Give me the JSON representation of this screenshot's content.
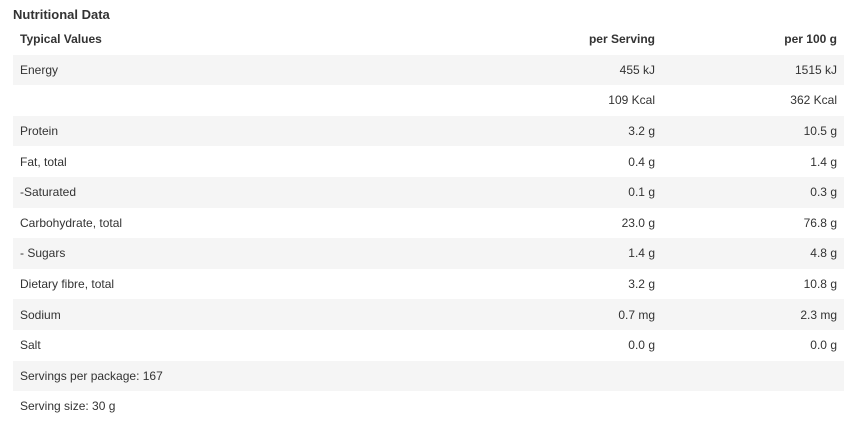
{
  "title": "Nutritional Data",
  "headers": {
    "label": "Typical Values",
    "per_serving": "per Serving",
    "per_100g": "per 100 g"
  },
  "rows": [
    {
      "label": "Energy",
      "per_serving": "455 kJ",
      "per_100g": "1515 kJ"
    },
    {
      "label": "",
      "per_serving": "109 Kcal",
      "per_100g": "362 Kcal"
    },
    {
      "label": "Protein",
      "per_serving": "3.2 g",
      "per_100g": "10.5 g"
    },
    {
      "label": "Fat, total",
      "per_serving": "0.4 g",
      "per_100g": "1.4 g"
    },
    {
      "label": "-Saturated",
      "per_serving": "0.1 g",
      "per_100g": "0.3 g"
    },
    {
      "label": "Carbohydrate, total",
      "per_serving": "23.0 g",
      "per_100g": "76.8 g"
    },
    {
      "label": "- Sugars",
      "per_serving": "1.4 g",
      "per_100g": "4.8 g"
    },
    {
      "label": "Dietary fibre, total",
      "per_serving": "3.2 g",
      "per_100g": "10.8 g"
    },
    {
      "label": "Sodium",
      "per_serving": "0.7 mg",
      "per_100g": "2.3 mg"
    },
    {
      "label": "Salt",
      "per_serving": "0.0 g",
      "per_100g": "0.0 g"
    }
  ],
  "footer": {
    "servings_per_package": "Servings per package: 167",
    "serving_size": "Serving size: 30 g"
  },
  "colors": {
    "stripe": "#f5f5f5",
    "text": "#333333",
    "background": "#ffffff"
  }
}
